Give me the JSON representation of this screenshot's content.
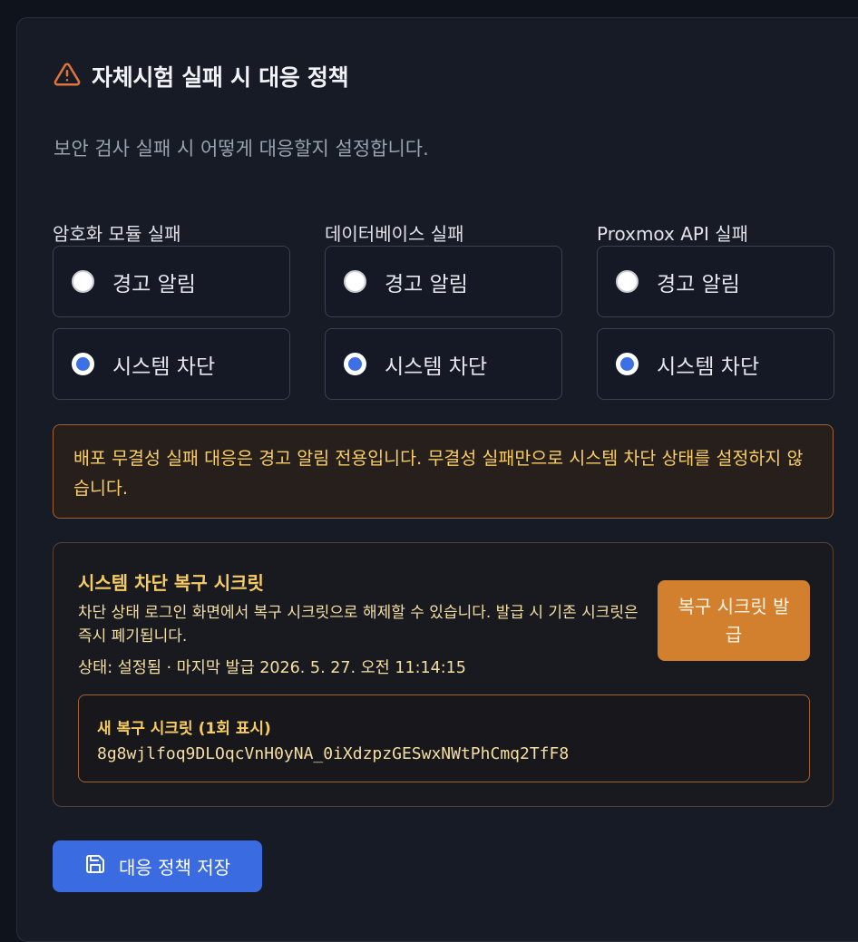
{
  "panel": {
    "title": "자체시험 실패 시 대응 정책",
    "subtitle": "보안 검사 실패 시 어떻게 대응할지 설정합니다."
  },
  "groups": [
    {
      "label": "암호화 모듈 실패",
      "options": [
        {
          "label": "경고 알림",
          "selected": false
        },
        {
          "label": "시스템 차단",
          "selected": true
        }
      ]
    },
    {
      "label": "데이터베이스 실패",
      "options": [
        {
          "label": "경고 알림",
          "selected": false
        },
        {
          "label": "시스템 차단",
          "selected": true
        }
      ]
    },
    {
      "label": "Proxmox API 실패",
      "options": [
        {
          "label": "경고 알림",
          "selected": false
        },
        {
          "label": "시스템 차단",
          "selected": true
        }
      ]
    }
  ],
  "notice": "배포 무결성 실패 대응은 경고 알림 전용입니다. 무결성 실패만으로 시스템 차단 상태를 설정하지 않습니다.",
  "recovery": {
    "title": "시스템 차단 복구 시크릿",
    "description": "차단 상태 로그인 화면에서 복구 시크릿으로 해제할 수 있습니다. 발급 시 기존 시크릿은 즉시 폐기됩니다.",
    "status": "상태: 설정됨 · 마지막 발급 2026. 5. 27. 오전 11:14:15",
    "issue_button": "복구 시크릿 발급",
    "new_secret_label": "새 복구 시크릿 (1회 표시)",
    "new_secret_value": "8g8wjlfoq9DLOqcVnH0yNA_0iXdzpzGESwxNWtPhCmq2TfF8"
  },
  "save_button": "대응 정책 저장",
  "colors": {
    "accent": "#3b6be0",
    "warning": "#f7cc63",
    "issue_button": "#d27f2e"
  }
}
